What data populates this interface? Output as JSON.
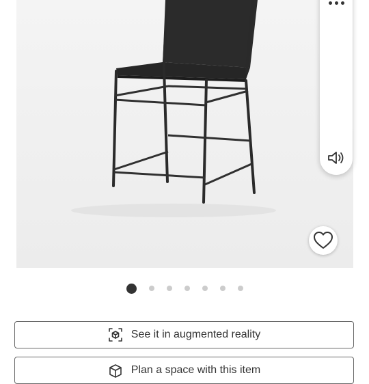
{
  "gallery": {
    "slide_count": 7,
    "active_index": 0
  },
  "side_rail": {
    "more_icon": "more-horizontal-icon",
    "audio_icon": "speaker-icon"
  },
  "favorite_icon": "heart-outline-icon",
  "actions": {
    "ar_label": "See it in augmented reality",
    "ar_icon": "ar-cube-icon",
    "plan_label": "Plan a space with this item",
    "plan_icon": "room-plan-icon"
  },
  "colors": {
    "active_dot": "#333333",
    "inactive_dot": "#cccccc",
    "button_border": "#666666"
  }
}
